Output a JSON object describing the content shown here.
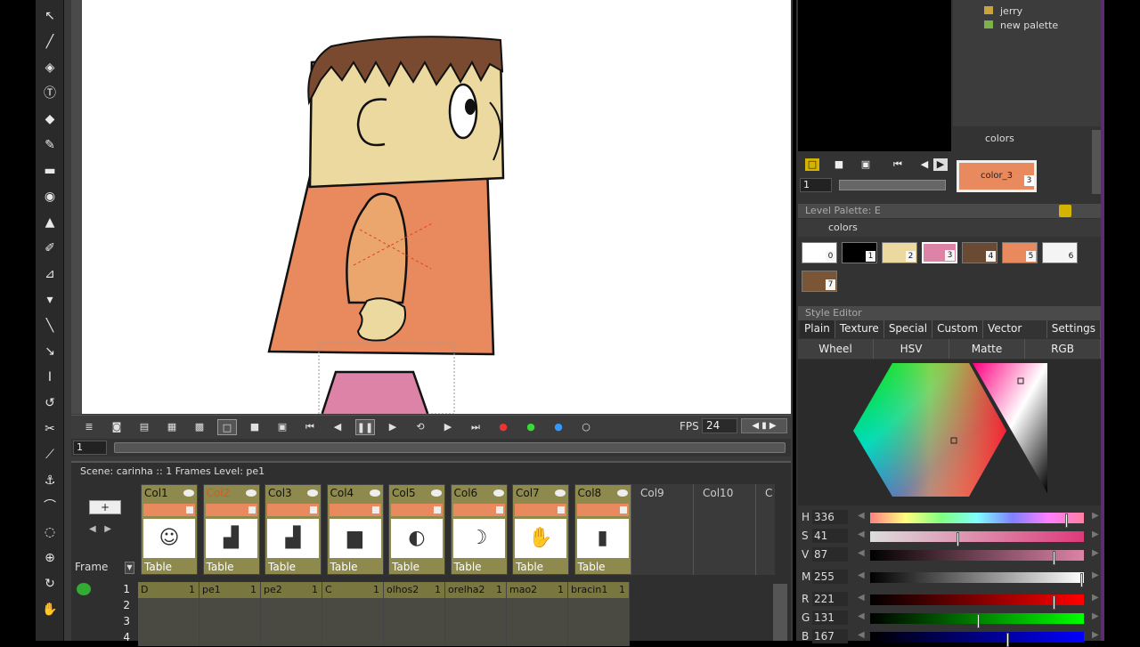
{
  "tools": [
    "select-tool",
    "brush-tool",
    "geometric-tool",
    "type-tool",
    "fill-tool",
    "paint-brush-tool",
    "eraser-tool",
    "tape-tool",
    "style-picker-tool",
    "rgb-picker-tool",
    "control-point-editor-tool",
    "pinch-tool",
    "pump-tool",
    "magnet-tool",
    "bender-tool",
    "iron-tool",
    "cutter-tool",
    "skeleton-tool",
    "tracker-tool",
    "hook-tool",
    "plastic-tool",
    "zoom-tool",
    "rotate-tool",
    "hand-tool"
  ],
  "viewer": {
    "fps_label": "FPS",
    "fps_value": "24",
    "frame_value": "1"
  },
  "xsheet": {
    "scene_info": "Scene: carinha  ::  1 Frames  Level: pe1",
    "frame_label": "Frame",
    "add_label": "+",
    "columns": [
      {
        "name": "Col1",
        "type": "Table",
        "thumb": "face"
      },
      {
        "name": "Col2",
        "type": "Table",
        "thumb": "legs"
      },
      {
        "name": "Col3",
        "type": "Table",
        "thumb": "legs"
      },
      {
        "name": "Col4",
        "type": "Table",
        "thumb": "body"
      },
      {
        "name": "Col5",
        "type": "Table",
        "thumb": "eye"
      },
      {
        "name": "Col6",
        "type": "Table",
        "thumb": "ear"
      },
      {
        "name": "Col7",
        "type": "Table",
        "thumb": "hand"
      },
      {
        "name": "Col8",
        "type": "Table",
        "thumb": "arm"
      }
    ],
    "empty_columns": [
      "Col9",
      "Col10",
      "C"
    ],
    "rows": [
      "1",
      "2",
      "3",
      "4"
    ],
    "cells": [
      {
        "level": "D",
        "frame": "1"
      },
      {
        "level": "pe1",
        "frame": "1"
      },
      {
        "level": "pe2",
        "frame": "1"
      },
      {
        "level": "C",
        "frame": "1"
      },
      {
        "level": "olhos2",
        "frame": "1"
      },
      {
        "level": "orelha2",
        "frame": "1"
      },
      {
        "level": "mao2",
        "frame": "1"
      },
      {
        "level": "bracin1",
        "frame": "1"
      }
    ]
  },
  "palette_tree": {
    "items": [
      "jerry",
      "new palette"
    ]
  },
  "studio_palette": {
    "tab_name": "colors",
    "current_chip": "color_3",
    "current_index": "3",
    "frame_value": "1"
  },
  "level_palette": {
    "header": "Level Palette: E",
    "name": "colors",
    "chips": [
      {
        "index": "0",
        "color": "#ffffff"
      },
      {
        "index": "1",
        "color": "#000000"
      },
      {
        "index": "2",
        "color": "#ecd9a0"
      },
      {
        "index": "3",
        "color": "#dd83a7"
      },
      {
        "index": "4",
        "color": "#6b4a34"
      },
      {
        "index": "5",
        "color": "#e98a5e"
      },
      {
        "index": "6",
        "color": "#f4f4f4"
      },
      {
        "index": "7",
        "color": "#7a5636"
      }
    ]
  },
  "style_editor": {
    "header": "Style Editor",
    "tabs": [
      "Plain",
      "Texture",
      "Special",
      "Custom",
      "Vector Brush",
      "Settings"
    ],
    "modes": [
      "Wheel",
      "HSV",
      "Matte",
      "RGB"
    ],
    "channels": [
      {
        "label": "H",
        "value": "336",
        "level": 0.93
      },
      {
        "label": "S",
        "value": "41",
        "level": 0.41
      },
      {
        "label": "V",
        "value": "87",
        "level": 0.87
      },
      {
        "label": "M",
        "value": "255",
        "level": 1.0
      },
      {
        "label": "R",
        "value": "221",
        "level": 0.87
      },
      {
        "label": "G",
        "value": "131",
        "level": 0.51
      },
      {
        "label": "B",
        "value": "167",
        "level": 0.65
      }
    ]
  }
}
